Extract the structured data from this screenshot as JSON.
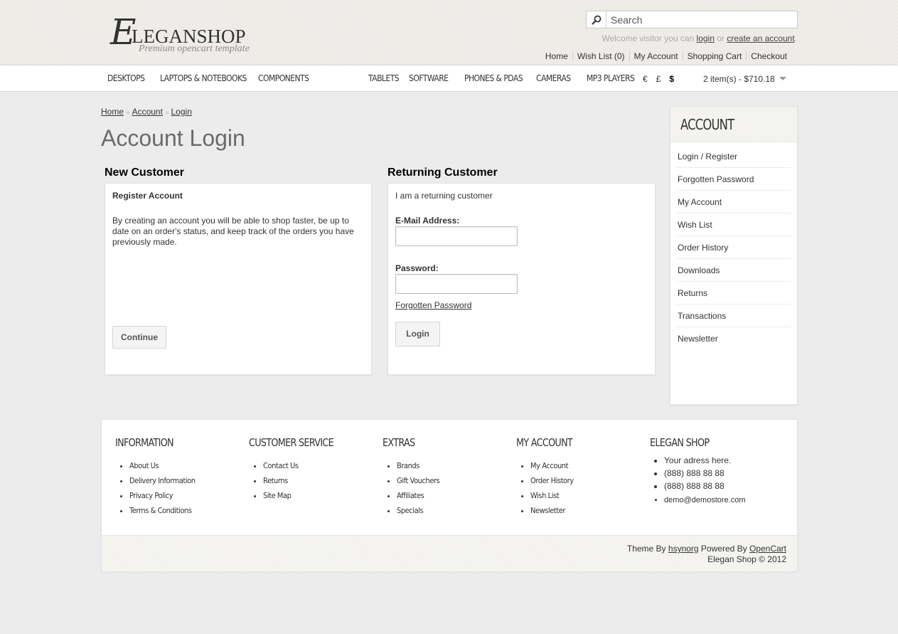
{
  "logo": {
    "initial": "E",
    "name": "LEGANSHOP",
    "tagline": "Premium opencart template"
  },
  "search": {
    "placeholder": "Search"
  },
  "welcome": {
    "prefix": "Welcome visitor you can ",
    "login": "login",
    "or": " or ",
    "create": "create an account",
    "suffix": "."
  },
  "top_links": [
    "Home",
    "Wish List (0)",
    "My Account",
    "Shopping Cart",
    "Checkout"
  ],
  "menu": {
    "categories": [
      "DESKTOPS",
      "LAPTOPS & NOTEBOOKS",
      "COMPONENTS",
      "TABLETS",
      "SOFTWARE",
      "PHONES & PDAS",
      "CAMERAS",
      "MP3 PLAYERS"
    ],
    "currencies": [
      "€",
      "£",
      "$"
    ],
    "active_currency": "$",
    "cart": "2 item(s) - $710.18"
  },
  "breadcrumb": [
    "Home",
    "Account",
    "Login"
  ],
  "breadcrumb_sep": "»",
  "page_title": "Account Login",
  "new_customer": {
    "heading": "New Customer",
    "subheading": "Register Account",
    "text": "By creating an account you will be able to shop faster, be up to date on an order's status, and keep track of the orders you have previously made.",
    "button": "Continue"
  },
  "returning_customer": {
    "heading": "Returning Customer",
    "intro": "I am a returning customer",
    "email_label": "E-Mail Address:",
    "email_value": "",
    "password_label": "Password:",
    "password_value": "",
    "forgot": "Forgotten Password",
    "button": "Login"
  },
  "sidebar": {
    "title": "ACCOUNT",
    "items": [
      "Login / Register",
      "Forgotten Password",
      "My Account",
      "Wish List",
      "Order History",
      "Downloads",
      "Returns",
      "Transactions",
      "Newsletter"
    ]
  },
  "footer": {
    "columns": [
      {
        "title": "INFORMATION",
        "items": [
          "About Us",
          "Delivery Information",
          "Privacy Policy",
          "Terms & Conditions"
        ]
      },
      {
        "title": "CUSTOMER SERVICE",
        "items": [
          "Contact Us",
          "Returns",
          "Site Map"
        ]
      },
      {
        "title": "EXTRAS",
        "items": [
          "Brands",
          "Gift Vouchers",
          "Affiliates",
          "Specials"
        ]
      },
      {
        "title": "MY ACCOUNT",
        "items": [
          "My Account",
          "Order History",
          "Wish List",
          "Newsletter"
        ]
      }
    ],
    "contact": {
      "title": "ELEGAN SHOP",
      "address": "Your adress here.",
      "phone1": "(888) 888 88 88",
      "phone2": "(888) 888 88 88",
      "email": "demo@demostore.com"
    },
    "powered": {
      "theme_by": "Theme By ",
      "author": "hsynorg",
      "powered_by": " Powered By ",
      "platform": "OpenCart",
      "copyright": "Elegan Shop © 2012"
    }
  }
}
